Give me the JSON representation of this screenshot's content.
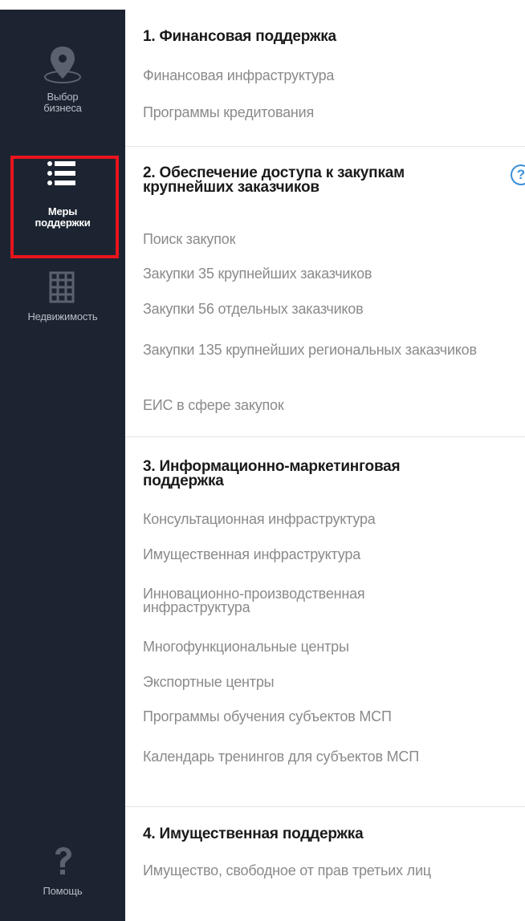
{
  "sidebar": {
    "items": [
      {
        "label": "Выбор бизнеса",
        "icon": "map-pin-icon"
      },
      {
        "label": "Меры поддержки",
        "icon": "list-icon",
        "active": true
      },
      {
        "label": "Недвижимость",
        "icon": "building-grid-icon"
      },
      {
        "label": "Помощь",
        "icon": "question-icon"
      }
    ],
    "active_border_color": "#e8141c",
    "background": "#1c2431"
  },
  "sections": [
    {
      "title": "1. Финансовая поддержка",
      "items": [
        "Финансовая инфраструктура",
        "Программы кредитования"
      ]
    },
    {
      "title": "2. Обеспечение доступа к закупкам крупнейших заказчиков",
      "help_icon": "?",
      "items": [
        "Поиск закупок",
        "Закупки 35 крупнейших заказчиков",
        "Закупки 56 отдельных заказчиков",
        "Закупки 135 крупнейших региональных заказчиков",
        "ЕИС в сфере закупок"
      ]
    },
    {
      "title": "3. Информационно-маркетинговая поддержка",
      "items": [
        "Консультационная инфраструктура",
        "Имущественная инфраструктура",
        "Инновационно-производственная инфраструктура",
        "Многофункциональные центры",
        "Экспортные центры",
        "Программы обучения субъектов МСП",
        "Календарь тренингов для субъектов МСП"
      ]
    },
    {
      "title": "4. Имущественная поддержка",
      "items": [
        "Имущество, свободное от прав третьих лиц"
      ]
    }
  ]
}
